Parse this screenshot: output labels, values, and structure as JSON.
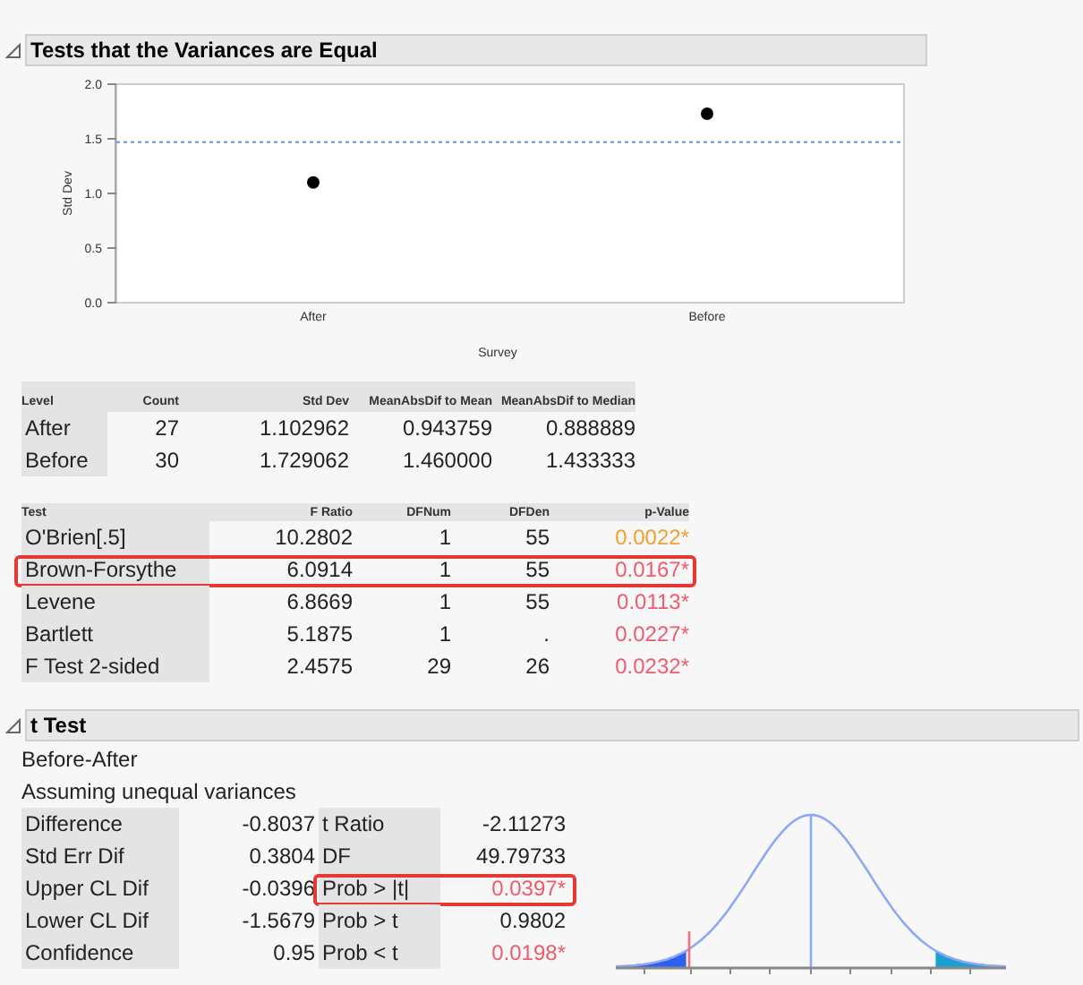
{
  "variances": {
    "title": "Tests that the Variances are Equal",
    "expanded": true,
    "chart_data": {
      "type": "scatter",
      "xlabel": "Survey",
      "ylabel": "Std Dev",
      "categories": [
        "After",
        "Before"
      ],
      "values": [
        1.1,
        1.73
      ],
      "ylim": [
        0,
        2
      ],
      "yticks": [
        {
          "value": 0,
          "label": "0.0"
        },
        {
          "value": 0.5,
          "label": "0.5"
        },
        {
          "value": 1,
          "label": "1.0"
        },
        {
          "value": 1.5,
          "label": "1.5"
        },
        {
          "value": 2,
          "label": "2.0"
        }
      ],
      "ref_lines": [
        {
          "axis": "y",
          "value": 1.47
        }
      ]
    },
    "level_table": {
      "columns": [
        "Level",
        "Count",
        "Std Dev",
        "MeanAbsDif to Mean",
        "MeanAbsDif to Median"
      ],
      "rows": [
        [
          "After",
          "27",
          "1.102962",
          "0.943759",
          "0.888889"
        ],
        [
          "Before",
          "30",
          "1.729062",
          "1.460000",
          "1.433333"
        ]
      ]
    },
    "test_table": {
      "columns": [
        "Test",
        "F Ratio",
        "DFNum",
        "DFDen",
        "p-Value"
      ],
      "rows": [
        {
          "cells": [
            "O'Brien[.5]",
            "10.2802",
            "1",
            "55",
            "0.0022*"
          ],
          "color": "#f0a030",
          "highlighted": false
        },
        {
          "cells": [
            "Brown-Forsythe",
            "6.0914",
            "1",
            "55",
            "0.0167*"
          ],
          "color": "#f05a6e",
          "highlighted": true
        },
        {
          "cells": [
            "Levene",
            "6.8669",
            "1",
            "55",
            "0.0113*"
          ],
          "color": "#f05a6e",
          "highlighted": false
        },
        {
          "cells": [
            "Bartlett",
            "5.1875",
            "1",
            ".",
            "0.0227*"
          ],
          "color": "#f05a6e",
          "highlighted": false
        },
        {
          "cells": [
            "F Test 2-sided",
            "2.4575",
            "29",
            "26",
            "0.0232*"
          ],
          "color": "#f05a6e",
          "highlighted": false
        }
      ]
    }
  },
  "t_test": {
    "title": "t Test",
    "expanded": true,
    "comparison": "Before-After",
    "assumption": "Assuming unequal variances",
    "rows": [
      {
        "label": "Difference",
        "value": "-0.8037",
        "stat": "t Ratio",
        "stat_value": "-2.11273",
        "color": null,
        "highlighted": false
      },
      {
        "label": "Std Err Dif",
        "value": "0.3804",
        "stat": "DF",
        "stat_value": "49.79733",
        "color": null,
        "highlighted": false
      },
      {
        "label": "Upper CL Dif",
        "value": "-0.0396",
        "stat": "Prob > |t|",
        "stat_value": "0.0397*",
        "color": "#f05a6e",
        "highlighted": true
      },
      {
        "label": "Lower CL Dif",
        "value": "-1.5679",
        "stat": "Prob > t",
        "stat_value": "0.9802",
        "color": null,
        "highlighted": false
      },
      {
        "label": "Confidence",
        "value": "0.95",
        "stat": "Prob < t",
        "stat_value": "0.0198*",
        "color": "#f05a6e",
        "highlighted": false
      }
    ]
  }
}
